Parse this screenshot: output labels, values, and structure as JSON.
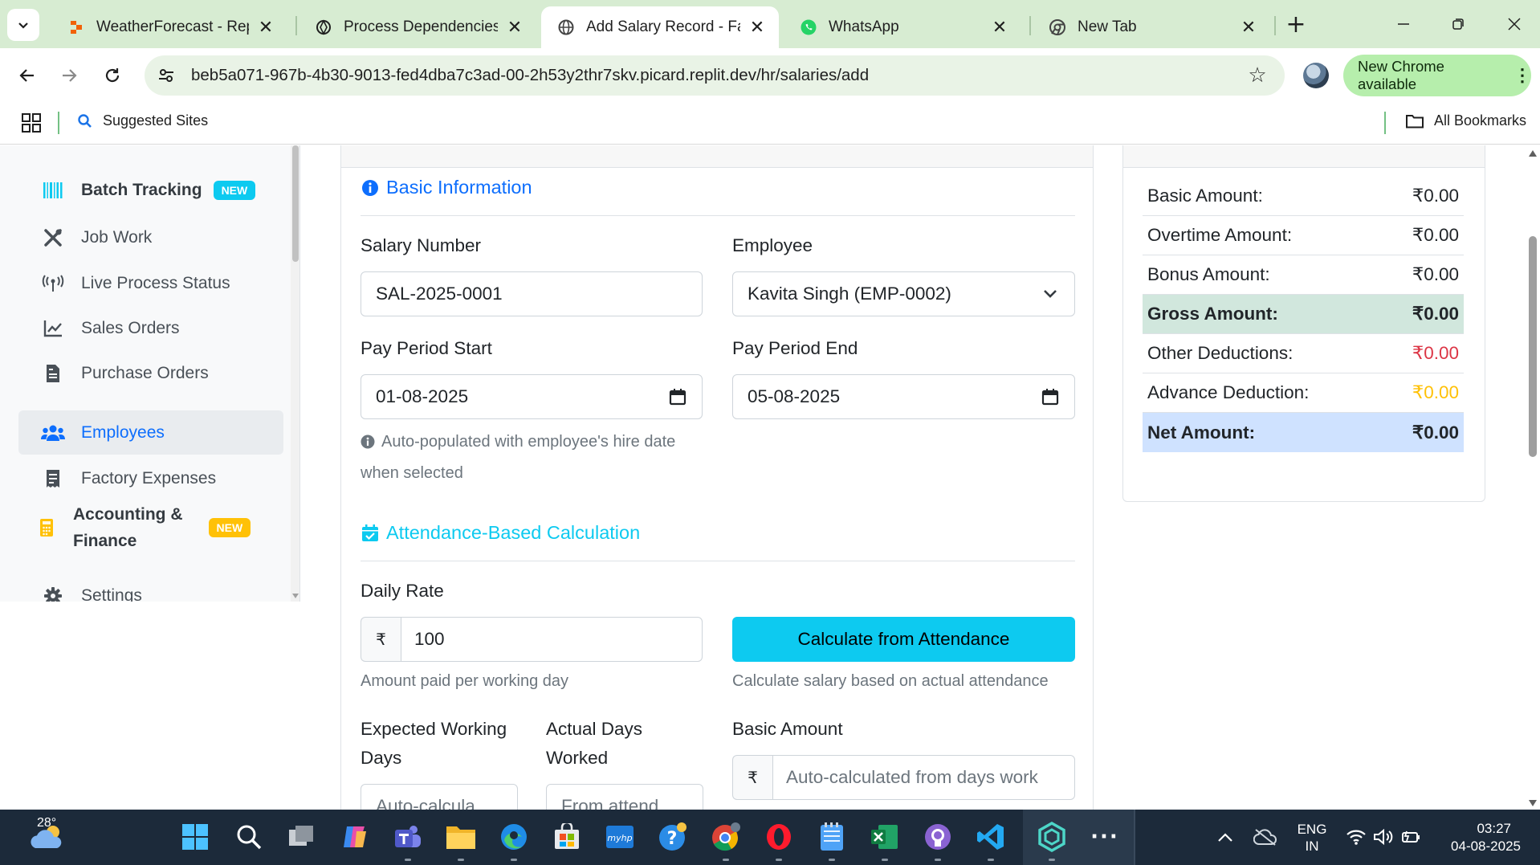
{
  "browser": {
    "tabs": [
      {
        "title": "WeatherForecast - Replit",
        "icon": "replit-icon",
        "active": false
      },
      {
        "title": "Process Dependencies O",
        "icon": "openai-icon",
        "active": false
      },
      {
        "title": "Add Salary Record - Facto",
        "icon": "globe-icon",
        "active": true
      },
      {
        "title": "WhatsApp",
        "icon": "whatsapp-icon",
        "active": false
      },
      {
        "title": "New Tab",
        "icon": "chrome-icon",
        "active": false
      }
    ],
    "url": "beb5a071-967b-4b30-9013-fed4dba7c3ad-00-2h53y2thr7skv.picard.replit.dev/hr/salaries/add",
    "chrome_update_label": "New Chrome available",
    "bookmarks": {
      "suggested": "Suggested Sites",
      "all": "All Bookmarks"
    }
  },
  "sidebar": {
    "items": [
      {
        "label": "Batch Tracking",
        "icon": "barcode-icon",
        "badge": "NEW",
        "badge_color": "#0dcaf0"
      },
      {
        "label": "Job Work",
        "icon": "tools-icon"
      },
      {
        "label": "Live Process Status",
        "icon": "broadcast-icon"
      },
      {
        "label": "Sales Orders",
        "icon": "chart-line-icon"
      },
      {
        "label": "Purchase Orders",
        "icon": "file-invoice-icon"
      },
      {
        "label": "Employees",
        "icon": "users-icon",
        "active": true
      },
      {
        "label": "Factory Expenses",
        "icon": "receipt-icon"
      },
      {
        "label": "Accounting & Finance",
        "label_line1": "Accounting &",
        "label_line2": "Finance",
        "icon": "calculator-icon",
        "badge": "NEW",
        "badge_color": "#ffc107"
      },
      {
        "label": "Settings",
        "icon": "gear-icon"
      }
    ]
  },
  "form": {
    "basic_section_title": "Basic Information",
    "salary_number_label": "Salary Number",
    "salary_number_value": "SAL-2025-0001",
    "employee_label": "Employee",
    "employee_value": "Kavita Singh (EMP-0002)",
    "pay_start_label": "Pay Period Start",
    "pay_start_value": "01-08-2025",
    "pay_end_label": "Pay Period End",
    "pay_end_value": "05-08-2025",
    "hire_date_help_line1": "Auto-populated with employee's hire date",
    "hire_date_help_line2": "when selected",
    "attendance_section_title": "Attendance-Based Calculation",
    "daily_rate_label": "Daily Rate",
    "currency_symbol": "₹",
    "daily_rate_value": "100",
    "daily_rate_help": "Amount paid per working day",
    "calc_button_label": "Calculate from Attendance",
    "calc_help": "Calculate salary based on actual attendance",
    "expected_days_label_line1": "Expected Working",
    "expected_days_label_line2": "Days",
    "expected_days_placeholder": "Auto-calcula",
    "actual_days_label_line1": "Actual Days",
    "actual_days_label_line2": "Worked",
    "actual_days_placeholder": "From attend",
    "basic_amount_label": "Basic Amount",
    "basic_amount_placeholder": "Auto-calculated from days work"
  },
  "summary": {
    "rows": [
      {
        "label": "Basic Amount:",
        "value": "₹0.00",
        "value_color": "#212529",
        "bg": "#ffffff",
        "bold": false
      },
      {
        "label": "Overtime Amount:",
        "value": "₹0.00",
        "value_color": "#212529",
        "bg": "#ffffff",
        "bold": false
      },
      {
        "label": "Bonus Amount:",
        "value": "₹0.00",
        "value_color": "#212529",
        "bg": "#ffffff",
        "bold": false
      },
      {
        "label": "Gross Amount:",
        "value": "₹0.00",
        "value_color": "#000000",
        "bg": "#d1e7dd",
        "bold": true
      },
      {
        "label": "Other Deductions:",
        "value": "₹0.00",
        "value_color": "#dc3545",
        "bg": "#ffffff",
        "bold": false
      },
      {
        "label": "Advance Deduction:",
        "value": "₹0.00",
        "value_color": "#ffc107",
        "bg": "#ffffff",
        "bold": false
      },
      {
        "label": "Net Amount:",
        "value": "₹0.00",
        "value_color": "#000000",
        "bg": "#cfe2ff",
        "bold": true
      }
    ]
  },
  "taskbar": {
    "weather_temp": "28°",
    "lang_line1": "ENG",
    "lang_line2": "IN",
    "time": "03:27",
    "date": "04-08-2025"
  },
  "colors": {
    "primary": "#0d6efd",
    "info": "#0dcaf0",
    "tab_strip": "#d7ecd2"
  }
}
